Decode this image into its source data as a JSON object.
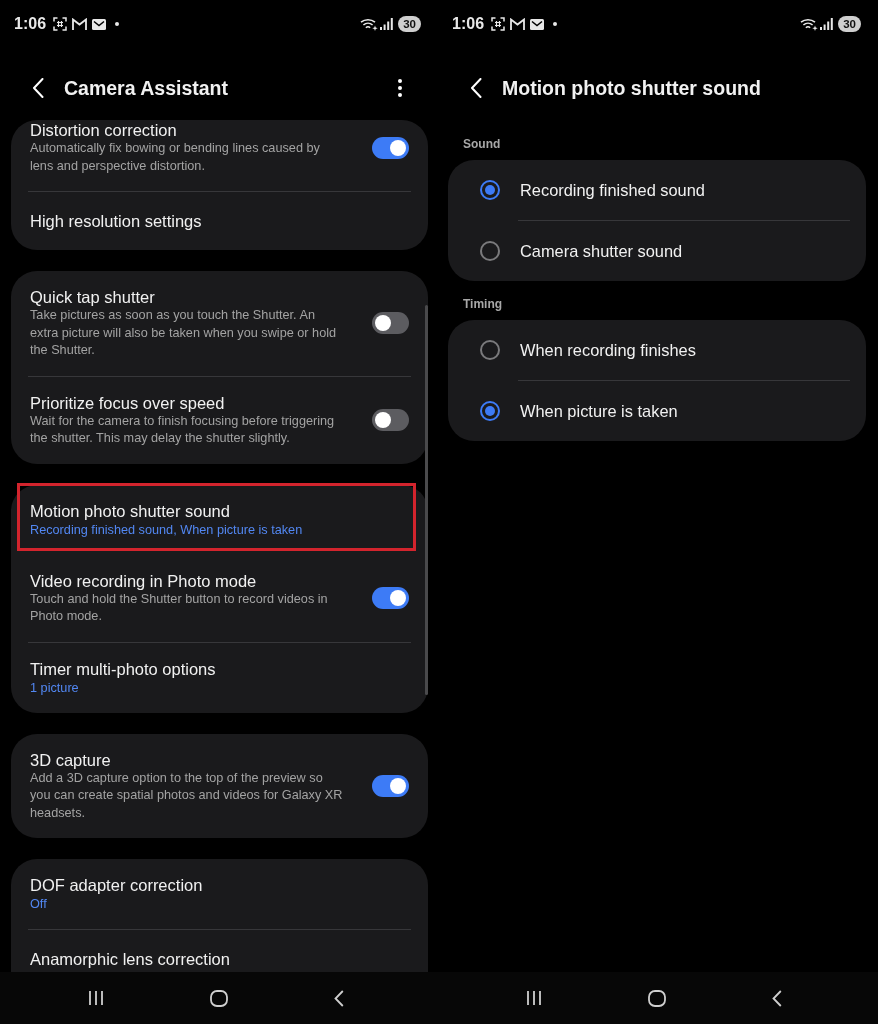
{
  "screens": [
    {
      "kind": "settings_list",
      "status_bar": {
        "time": "1:06",
        "battery": "30"
      },
      "header": {
        "title": "Camera Assistant",
        "more_menu": true
      },
      "cards": [
        {
          "items": [
            {
              "kind": "toggle",
              "title": "Distortion correction",
              "description": "Automatically fix bowing or bending lines caused by lens and perspective distortion.",
              "on": true,
              "highlighted": false
            },
            {
              "kind": "link",
              "title": "High resolution settings",
              "highlighted": false
            }
          ]
        },
        {
          "items": [
            {
              "kind": "toggle",
              "title": "Quick tap shutter",
              "description": "Take pictures as soon as you touch the Shutter. An extra picture will also be taken when you swipe or hold the Shutter.",
              "on": false,
              "highlighted": false
            },
            {
              "kind": "toggle",
              "title": "Prioritize focus over speed",
              "description": "Wait for the camera to finish focusing before triggering the shutter. This may delay the shutter slightly.",
              "on": false,
              "highlighted": false
            }
          ]
        },
        {
          "items": [
            {
              "kind": "link",
              "title": "Motion photo shutter sound",
              "value": "Recording finished sound, When picture is taken",
              "highlighted": true
            },
            {
              "kind": "toggle",
              "title": "Video recording in Photo mode",
              "description": "Touch and hold the Shutter button to record videos in Photo mode.",
              "on": true,
              "highlighted": false
            },
            {
              "kind": "link",
              "title": "Timer multi-photo options",
              "value": "1 picture",
              "highlighted": false
            }
          ]
        },
        {
          "items": [
            {
              "kind": "toggle",
              "title": "3D capture",
              "description": "Add a 3D capture option to the top of the preview so you can create spatial photos and videos for Galaxy XR headsets.",
              "on": true,
              "highlighted": false
            }
          ]
        },
        {
          "items": [
            {
              "kind": "link",
              "title": "DOF adapter correction",
              "value": "Off",
              "highlighted": false
            },
            {
              "kind": "link",
              "title": "Anamorphic lens correction",
              "highlighted": false
            }
          ]
        }
      ]
    },
    {
      "kind": "radio_page",
      "status_bar": {
        "time": "1:06",
        "battery": "30"
      },
      "header": {
        "title": "Motion photo shutter sound"
      },
      "groups": [
        {
          "label": "Sound",
          "options": [
            {
              "label": "Recording finished sound",
              "selected": true
            },
            {
              "label": "Camera shutter sound",
              "selected": false
            }
          ]
        },
        {
          "label": "Timing",
          "options": [
            {
              "label": "When recording finishes",
              "selected": false
            },
            {
              "label": "When picture is taken",
              "selected": true
            }
          ]
        }
      ]
    }
  ]
}
